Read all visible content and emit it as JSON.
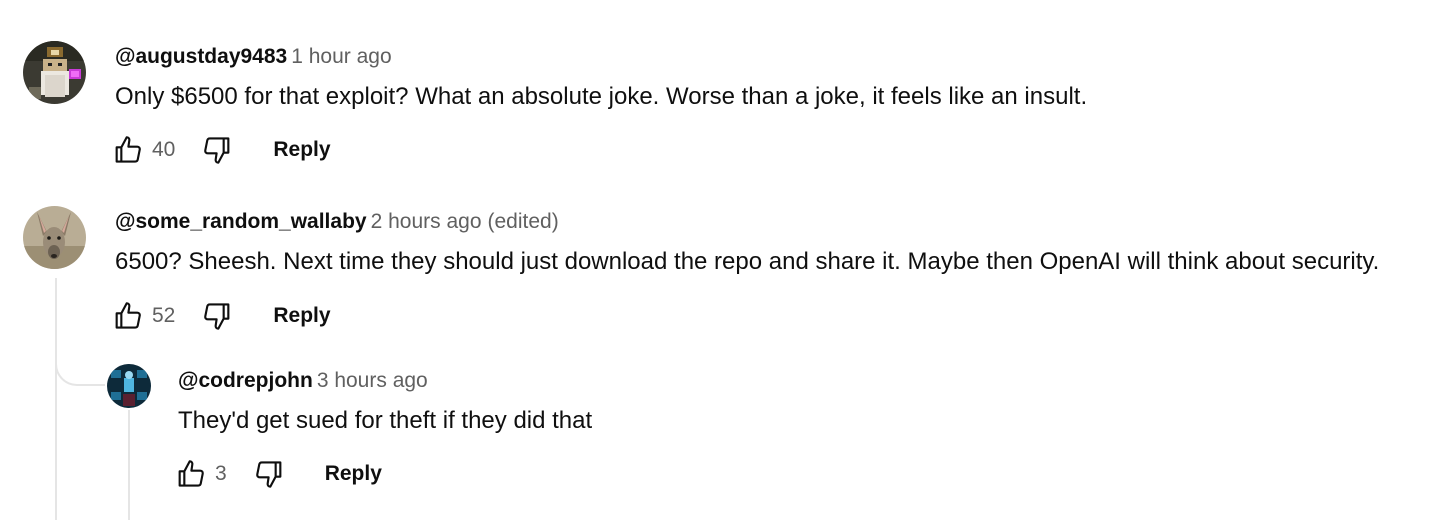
{
  "comments": [
    {
      "author": "@augustday9483",
      "time": "1 hour ago",
      "edited": "",
      "text": "Only $6500 for that exploit? What an absolute joke. Worse than a joke, it feels like an insult.",
      "likes": "40",
      "reply_label": "Reply"
    },
    {
      "author": "@some_random_wallaby",
      "time": "2 hours ago",
      "edited": "(edited)",
      "text": "6500? Sheesh. Next time they should just download the repo and share it. Maybe then OpenAI will think about security.",
      "likes": "52",
      "reply_label": "Reply"
    },
    {
      "author": "@codrepjohn",
      "time": "3 hours ago",
      "edited": "",
      "text": "They'd get sued for theft if they did that",
      "likes": "3",
      "reply_label": "Reply"
    }
  ],
  "icons": {
    "like": "thumbs-up-icon",
    "dislike": "thumbs-down-icon"
  },
  "colors": {
    "text": "#0f0f0f",
    "secondary": "#606060",
    "thread_line": "#e5e5e5"
  }
}
